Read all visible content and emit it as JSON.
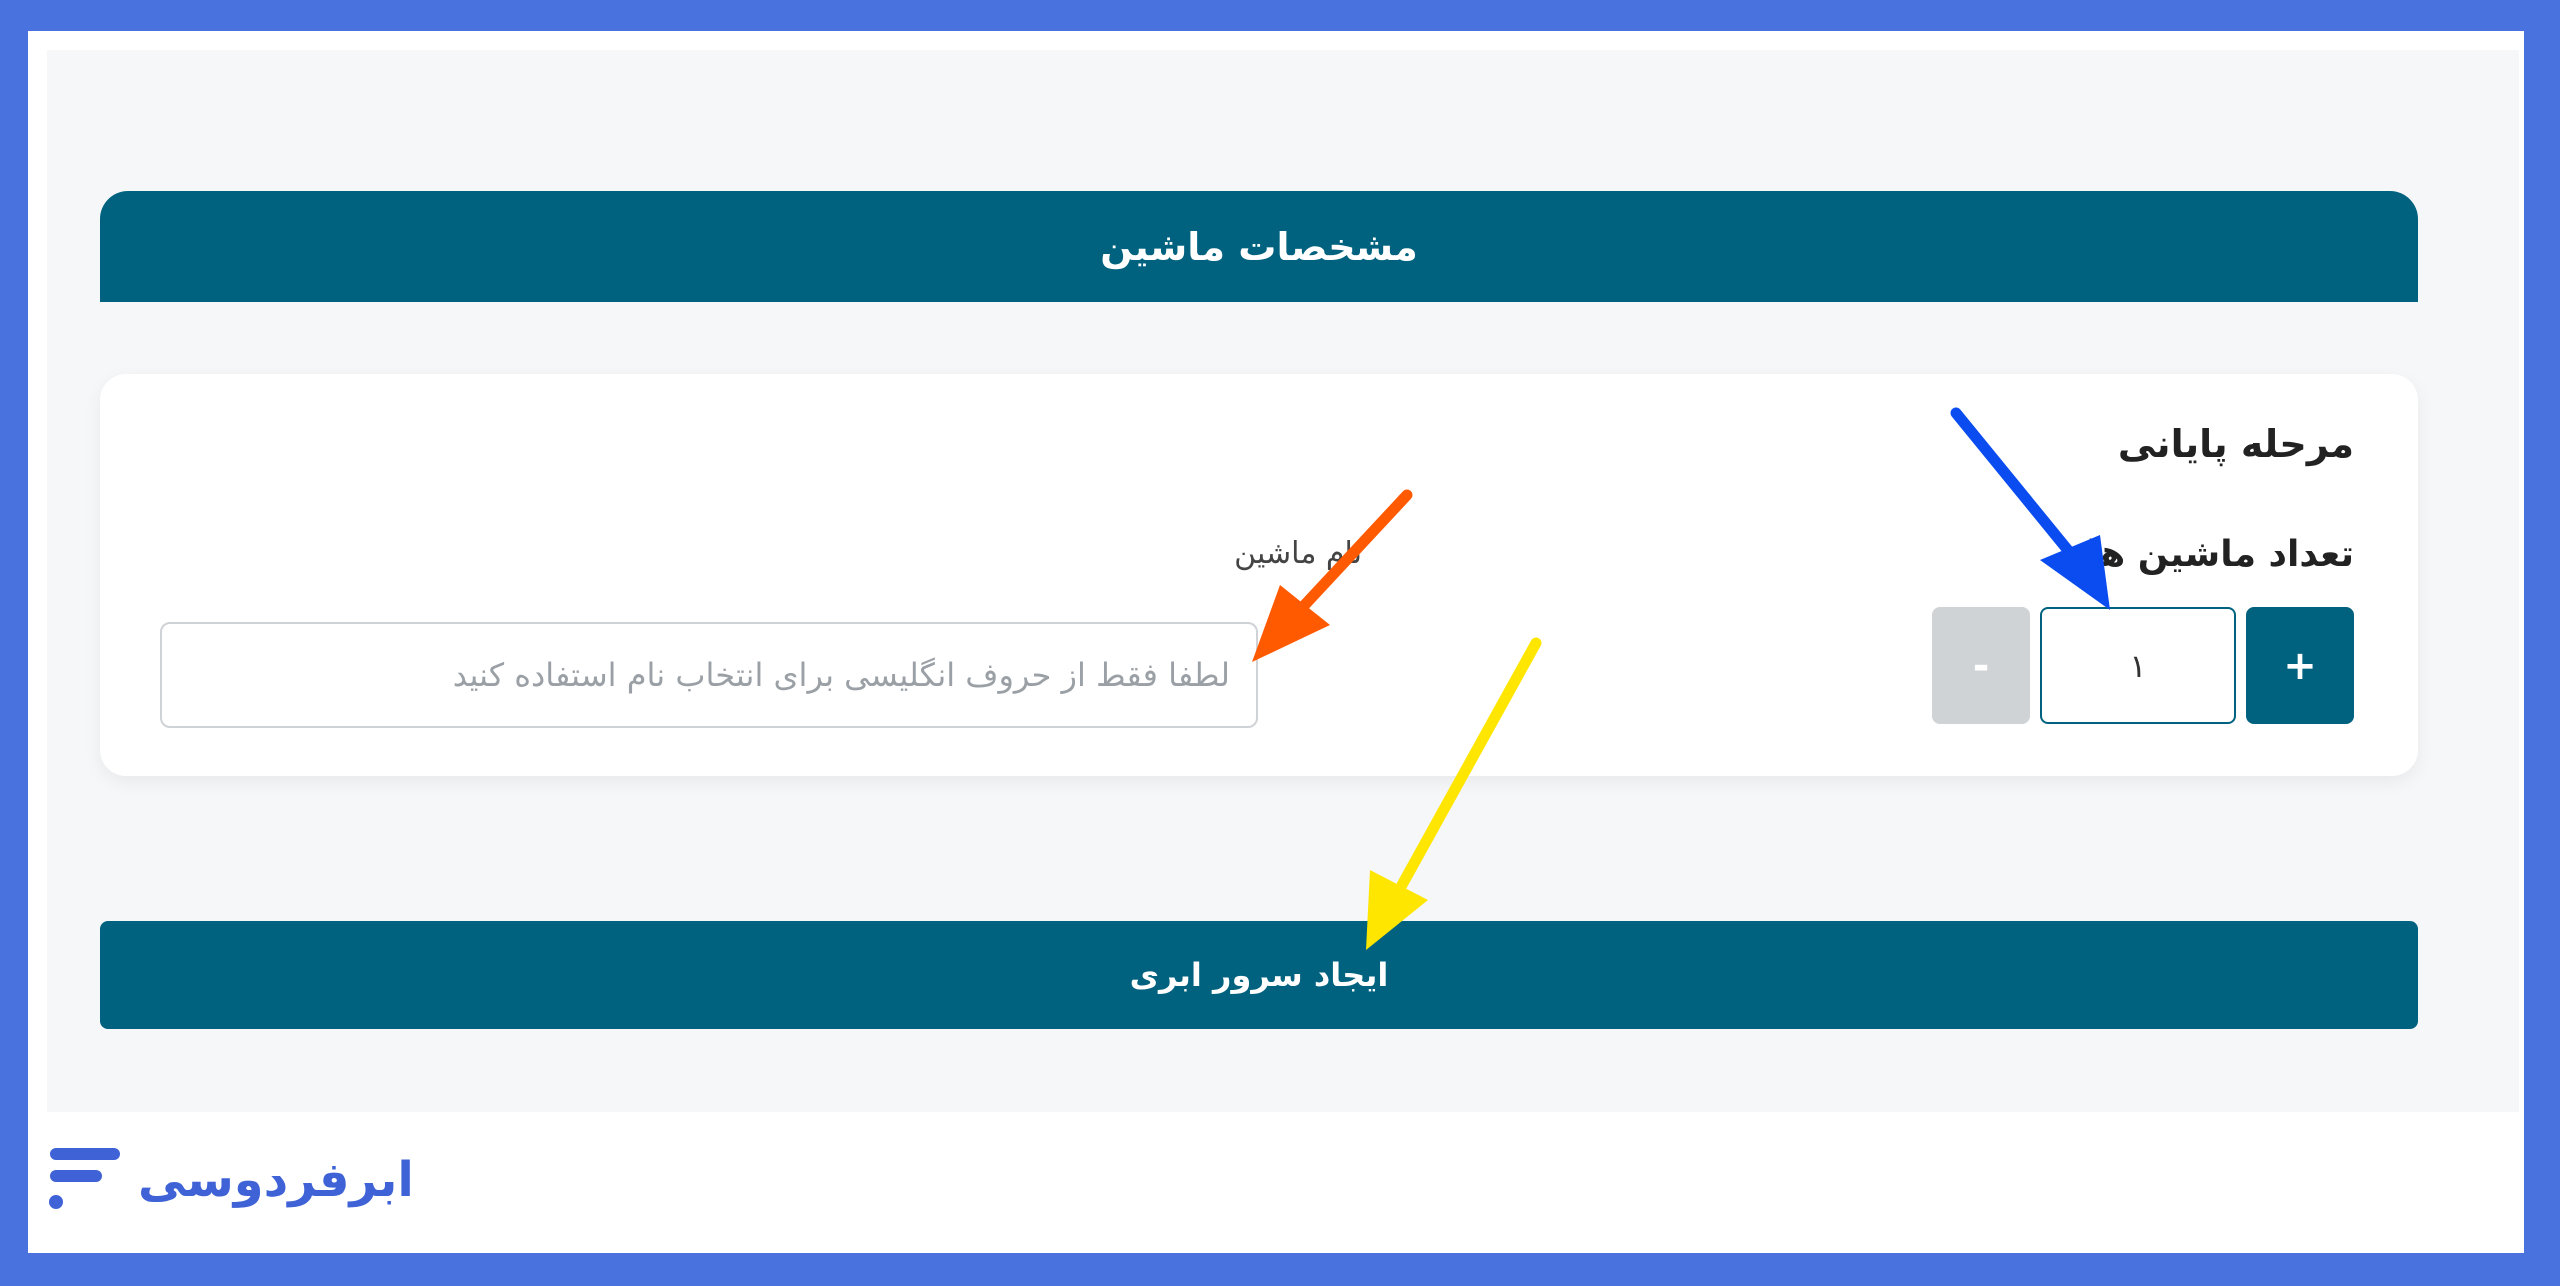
{
  "header": {
    "title": "مشخصات ماشین"
  },
  "stage": {
    "title": "مرحله پایانی",
    "count_label": "تعداد ماشین ها",
    "plus_label": "+",
    "minus_label": "-",
    "count_value": "۱"
  },
  "machine_name": {
    "label": "نام ماشین",
    "placeholder": "لطفا فقط از حروف انگلیسی برای انتخاب نام استفاده کنید",
    "value": ""
  },
  "actions": {
    "create_label": "ایجاد سرور ابری"
  },
  "brand": {
    "name": "ابرفردوسی"
  },
  "colors": {
    "primary": "#00627f",
    "frame": "#4a72de",
    "arrow_orange": "#ff5a00",
    "arrow_blue": "#0a4cf0",
    "arrow_yellow": "#ffe600"
  }
}
